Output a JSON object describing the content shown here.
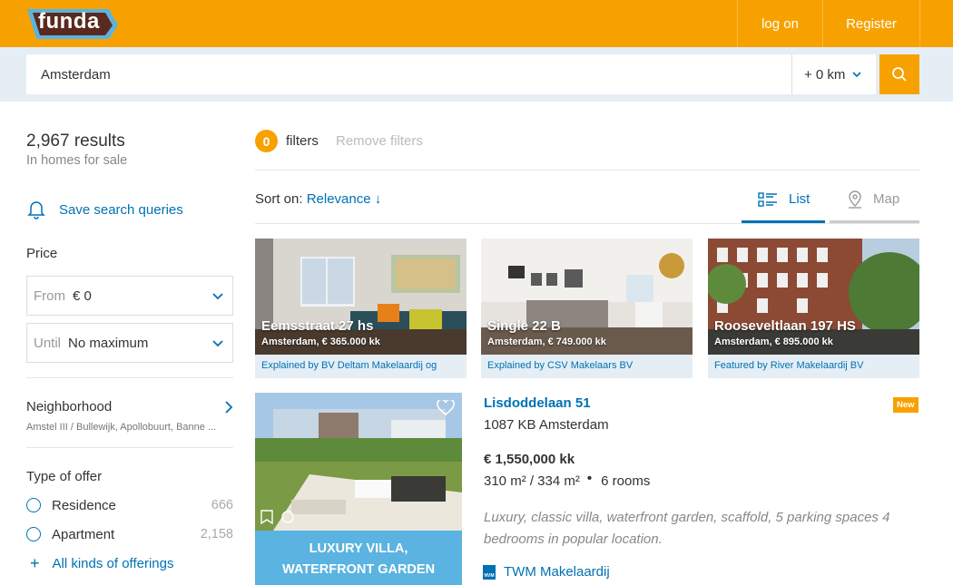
{
  "header": {
    "logo_text": "funda",
    "login_label": "log on",
    "register_label": "Register"
  },
  "search": {
    "value": "Amsterdam",
    "radius": "+ 0 km"
  },
  "results": {
    "count": "2,967 results",
    "subtitle": "In homes for sale",
    "save_search": "Save search queries"
  },
  "filters": {
    "count": "0",
    "label": "filters",
    "remove_label": "Remove filters"
  },
  "price": {
    "label": "Price",
    "from_label": "From",
    "from_value": "€ 0",
    "until_label": "Until",
    "until_value": "No maximum"
  },
  "neighborhood": {
    "label": "Neighborhood",
    "subtitle": "Amstel III / Bullewijk, Apollobuurt, Banne ..."
  },
  "offer": {
    "label": "Type of offer",
    "options": [
      {
        "label": "Residence",
        "count": "666"
      },
      {
        "label": "Apartment",
        "count": "2,158"
      }
    ],
    "all_label": "All kinds of offerings"
  },
  "sort": {
    "label": "Sort on:",
    "value": "Relevance ↓"
  },
  "view": {
    "list_label": "List",
    "map_label": "Map"
  },
  "cards": [
    {
      "title": "Eemsstraat 27 hs",
      "subtitle": "Amsterdam, € 365.000 kk",
      "agent": "Explained by BV Deltam Makelaardij og"
    },
    {
      "title": "Single 22 B",
      "subtitle": "Amsterdam, € 749.000 kk",
      "agent": "Explained by CSV Makelaars BV"
    },
    {
      "title": "Rooseveltlaan 197 HS",
      "subtitle": "Amsterdam, € 895.000 kk",
      "agent": "Featured by River Makelaardij BV"
    }
  ],
  "listing": {
    "title": "Lisdoddelaan 51",
    "zip": "1087 KB Amsterdam",
    "badge": "New",
    "price": "€ 1,550,000 kk",
    "area": "310 m² / 334 m²",
    "rooms": "6 rooms",
    "description": "Luxury, classic villa, waterfront garden, scaffold, 5 parking spaces 4 bedrooms in popular location.",
    "agent": "TWM Makelaardij",
    "agent_logo_text": "NVM",
    "banner_line1": "LUXURY VILLA,",
    "banner_line2": "WATERFRONT GARDEN"
  },
  "colors": {
    "brand": "#f7a100",
    "link": "#0071b3",
    "search_strip": "#e5eef5",
    "banner": "#5ab3e0"
  }
}
